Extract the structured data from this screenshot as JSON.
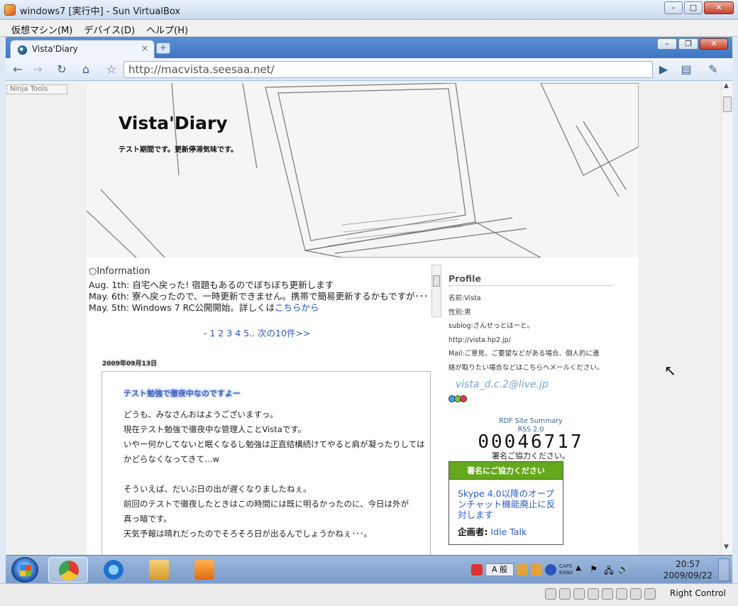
{
  "vbox": {
    "title": "windows7 [実行中] - Sun VirtualBox",
    "menu": [
      "仮想マシン(M)",
      "デバイス(D)",
      "ヘルプ(H)"
    ],
    "status_right_control": "Right Control"
  },
  "chrome": {
    "tab_label": "Vista'Diary",
    "tab_close": "×",
    "newtab": "+",
    "url": "http://macvista.seesaa.net/"
  },
  "ninja": "Ninja Tools",
  "site": {
    "title": "Vista'Diary",
    "subtitle": "テスト期間です。更新停滞気味です。"
  },
  "info": {
    "heading": "○Information",
    "lines": [
      "Aug. 1th: 自宅へ戻った! 宿題もあるのでぼちぼち更新します",
      "May. 6th: 寮へ戻ったので、一時更新できません。携帯で簡易更新するかもですが･･･",
      "May. 5th: Windows 7 RC公開開始。詳しくは"
    ],
    "link_text": "こちらから"
  },
  "pager": "- 1 2 3 4 5.. 次の10件>>",
  "post": {
    "date": "2009年09月13日",
    "title": "テスト勉強で徹夜中なのですよー",
    "body": [
      "どうも、みなさんおはようございますっ。",
      "現在テスト勉強で徹夜中な管理人ことVistaです。",
      "いやー何かしてないと眠くなるし勉強は正直結構続けてやると肩が凝ったりしては",
      "かどらなくなってきて…w",
      "",
      "そういえば、だいぶ日の出が遅くなりましたねぇ。",
      "前回のテストで徹夜したときはこの時間には既に明るかったのに、今日は外が",
      "真っ暗です。",
      "天気予報は晴れだったのでそろそろ日が出るんでしょうかねぇ･･･。"
    ]
  },
  "profile": {
    "heading": "Profile",
    "name": "名前:Vista",
    "gender": "性別:男",
    "sublog": "sublog:さんせっとはーと。",
    "url": "http://vista.hp2.jp/",
    "mail_line1": "Mail:ご意見、ご要望などがある場合、個人的に連",
    "mail_line2": "絡が取りたい場合などはこちらへメールください。",
    "mail_address": "vista_d.c.2@live.jp"
  },
  "rdf": {
    "line1": "RDF Site Summary",
    "line2": "RSS 2.0"
  },
  "counter": "00046717",
  "sign_note": "署名ご協力ください。",
  "petition": {
    "head": "署名にご協力ください",
    "link": "Skype 4.0以降のオープンチャット機能廃止に反対します",
    "organizer_label": "企画者:",
    "organizer": "Idle Talk"
  },
  "tray": {
    "ime": "A 般",
    "caps": "CAPS",
    "kana": "KANA"
  },
  "clock": {
    "time": "20:57",
    "date": "2009/09/22"
  }
}
